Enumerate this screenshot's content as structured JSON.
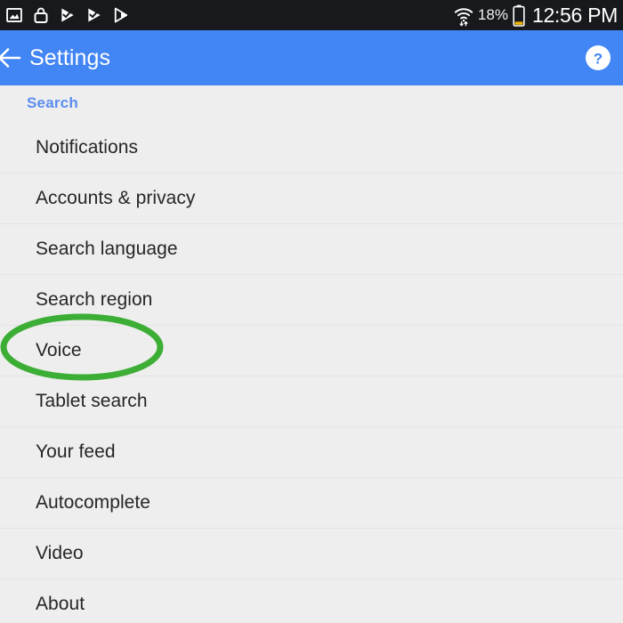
{
  "status_bar": {
    "background_color": "#17191c",
    "left_icons": [
      {
        "name": "screenshot-icon",
        "label": "Screenshot"
      },
      {
        "name": "lock-bag-icon",
        "label": "Secure"
      },
      {
        "name": "play-update-icon-1",
        "label": "Play update"
      },
      {
        "name": "play-update-icon-2",
        "label": "Play update"
      },
      {
        "name": "play-store-icon",
        "label": "Play Store"
      }
    ],
    "wifi_icon": "wifi-with-data-arrows-icon",
    "battery_percent": "18%",
    "battery_icon": "battery-low-icon",
    "clock": "12:56 PM"
  },
  "app_bar": {
    "background_color": "#4285f4",
    "back_icon": "back-arrow-icon",
    "title": "Settings",
    "help_icon": "help-question-icon"
  },
  "list": {
    "section_header": "Search",
    "section_header_color": "#5b8def",
    "items": [
      {
        "label": "Notifications"
      },
      {
        "label": "Accounts & privacy"
      },
      {
        "label": "Search language"
      },
      {
        "label": "Search region"
      },
      {
        "label": "Voice"
      },
      {
        "label": "Tablet search"
      },
      {
        "label": "Your feed"
      },
      {
        "label": "Autocomplete"
      },
      {
        "label": "Video"
      },
      {
        "label": "About"
      }
    ]
  },
  "annotation": {
    "type": "ellipse-highlight",
    "target_label": "Voice",
    "color": "#3cae35"
  }
}
